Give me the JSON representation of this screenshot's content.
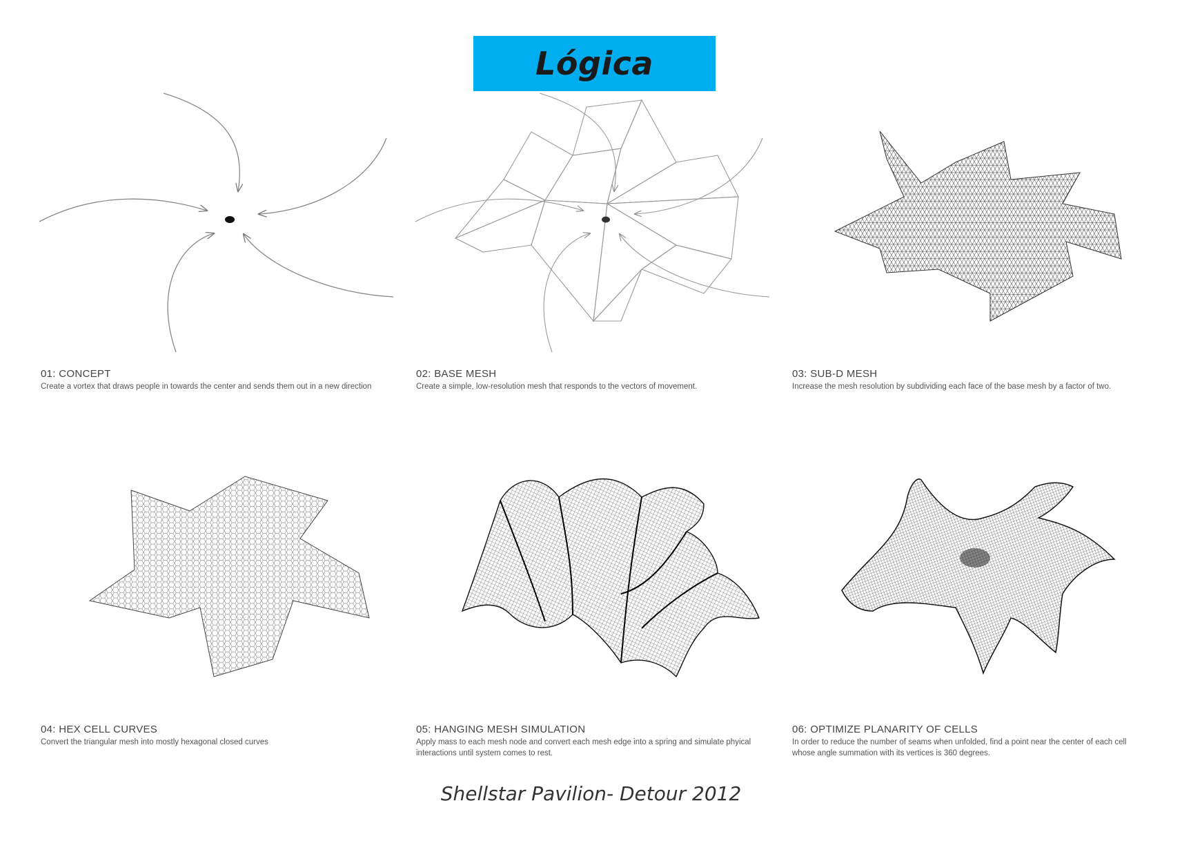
{
  "header": {
    "title": "Lógica"
  },
  "panels": [
    {
      "title": "01: CONCEPT",
      "desc": "Create a vortex that draws people in towards the center and sends them out in a new direction"
    },
    {
      "title": "02: BASE MESH",
      "desc": "Create a simple, low-resolution mesh that responds to the vectors of movement."
    },
    {
      "title": "03: SUB-D MESH",
      "desc": "Increase the mesh resolution by subdividing each face of the base mesh by a factor of two."
    },
    {
      "title": "04: HEX CELL CURVES",
      "desc": "Convert the triangular mesh into mostly hexagonal closed curves"
    },
    {
      "title": "05: HANGING MESH SIMULATION",
      "desc": "Apply mass to each mesh node and convert each mesh edge into a spring and simulate phyical interactions until system comes to rest."
    },
    {
      "title": "06: OPTIMIZE PLANARITY OF CELLS",
      "desc": "In order to reduce the number of seams when unfolded, find a point near the center of each cell whose angle summation with its vertices is 360 degrees."
    }
  ],
  "footer": {
    "caption": "Shellstar Pavilion- Detour 2012"
  },
  "colors": {
    "title_bg": "#00aeef",
    "line": "#777777",
    "mesh": "#333333"
  }
}
